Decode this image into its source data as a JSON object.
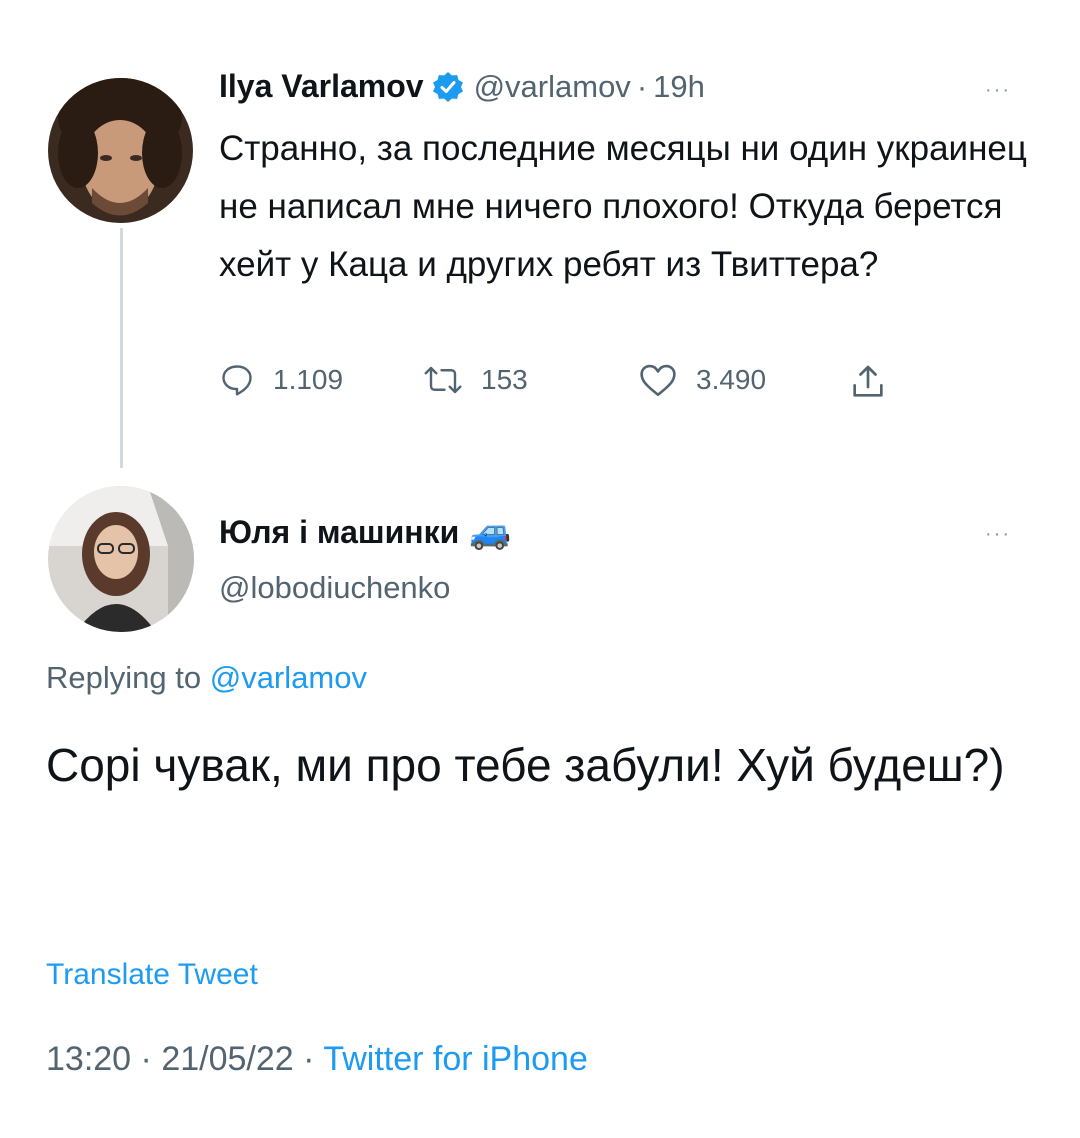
{
  "original_tweet": {
    "author_name": "Ilya Varlamov",
    "handle": "@varlamov",
    "separator": "·",
    "time": "19h",
    "more_label": "···",
    "text": "Странно, за последние месяцы ни один украинец не написал мне ничего плохого! Откуда берется хейт у Каца и других ребят из Твиттера?",
    "replies": "1.109",
    "retweets": "153",
    "likes": "3.490",
    "icons": [
      "verified-badge-icon",
      "reply-icon",
      "retweet-icon",
      "like-icon",
      "share-icon"
    ]
  },
  "reply_tweet": {
    "author_name": "Юля і машинки",
    "name_emoji": "🚙",
    "handle": "@lobodiuchenko",
    "more_label": "···",
    "replying_prefix": "Replying to",
    "replying_to": "@varlamov",
    "text": "Сорі чувак, ми про тебе забули! Хуй будеш?)",
    "translate_label": "Translate Tweet",
    "time": "13:20",
    "sep1": "·",
    "date": "21/05/22",
    "sep2": "·",
    "source": "Twitter for iPhone"
  },
  "colors": {
    "accent": "#1d9bf0",
    "secondary_text": "#536471",
    "primary_text": "#0f1419",
    "thread_line": "#cfd9de"
  }
}
